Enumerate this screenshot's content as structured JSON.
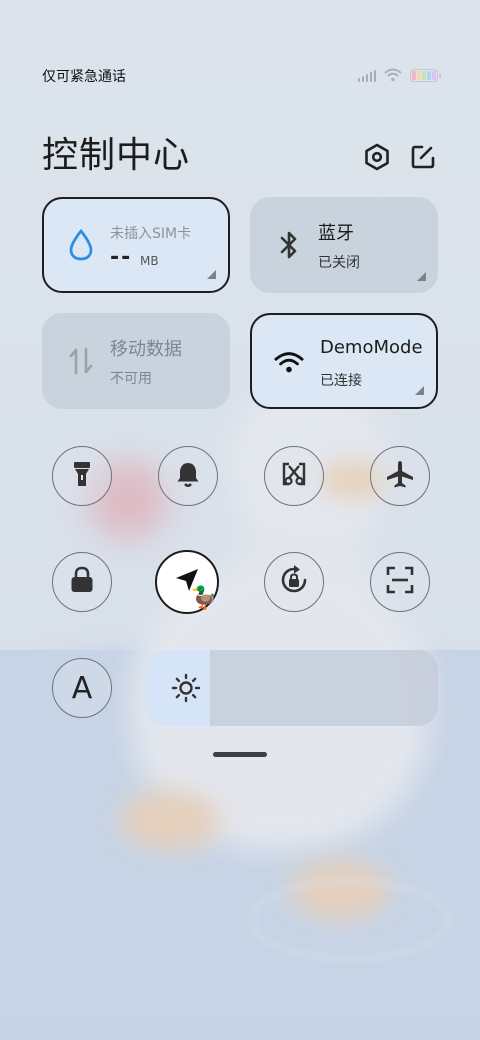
{
  "status_bar": {
    "carrier_text": "仅可紧急通话",
    "battery_colors": [
      "#f2b8c6",
      "#f6d7a8",
      "#c7e3b5",
      "#b6d4f0",
      "#d9c3ef"
    ]
  },
  "header": {
    "title": "控制中心",
    "settings_icon": "gear-hexagon-icon",
    "edit_icon": "edit-icon"
  },
  "tiles": {
    "data_usage": {
      "top_label": "未插入SIM卡",
      "value": "--",
      "unit": "MB",
      "icon": "water-drop-icon"
    },
    "bluetooth": {
      "title": "蓝牙",
      "status": "已关闭",
      "icon": "bluetooth-icon"
    },
    "mobile_data": {
      "title": "移动数据",
      "status": "不可用",
      "icon": "data-arrows-icon"
    },
    "wifi": {
      "title": "DemoMode",
      "status": "已连接",
      "icon": "wifi-icon"
    }
  },
  "toggles": [
    {
      "name": "flashlight",
      "icon": "flashlight-icon",
      "active": false
    },
    {
      "name": "ring",
      "icon": "bell-icon",
      "active": false
    },
    {
      "name": "screenshot",
      "icon": "scissors-icon",
      "active": false
    },
    {
      "name": "airplane",
      "icon": "airplane-icon",
      "active": false
    },
    {
      "name": "lock",
      "icon": "lock-icon",
      "active": false
    },
    {
      "name": "location",
      "icon": "location-arrow-icon",
      "active": true
    },
    {
      "name": "rotation-lock",
      "icon": "rotate-lock-icon",
      "active": false
    },
    {
      "name": "scanner",
      "icon": "scan-icon",
      "active": false
    }
  ],
  "font_toggle": {
    "letter": "A"
  },
  "brightness": {
    "level": 0.22,
    "icon": "sun-icon"
  },
  "colors": {
    "accent_blue": "#2d8ee8",
    "tile_active_bg": "#dbe7f5",
    "tile_inactive_bg": "#c4d0dc"
  }
}
